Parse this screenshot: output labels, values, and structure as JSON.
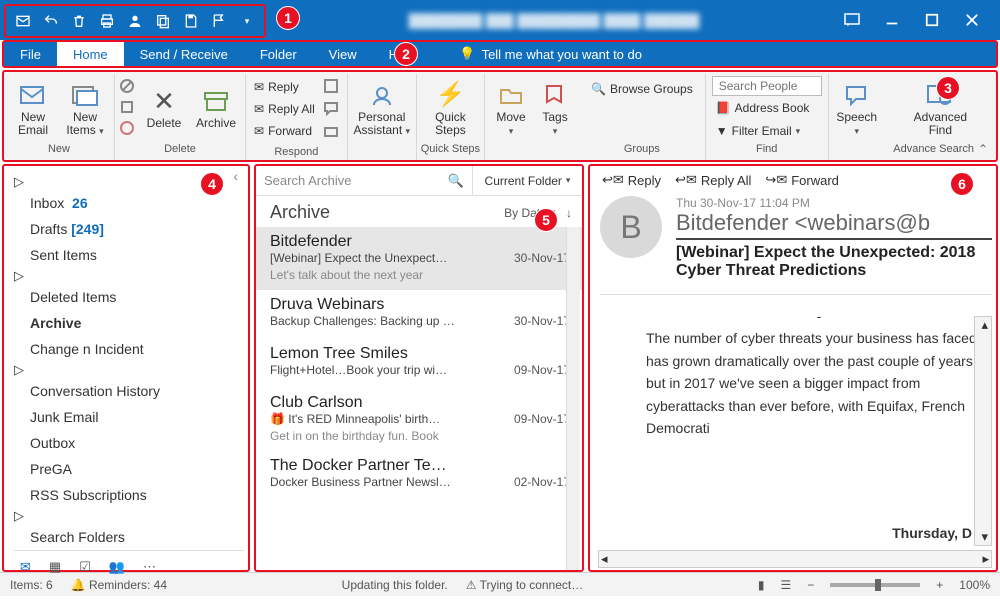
{
  "menus": {
    "file": "File",
    "home": "Home",
    "send": "Send / Receive",
    "folder": "Folder",
    "view": "View",
    "help": "Help",
    "tellme": "Tell me what you want to do"
  },
  "ribbon": {
    "new_email": "New\nEmail",
    "new_items": "New\nItems",
    "group_new": "New",
    "delete": "Delete",
    "archive": "Archive",
    "group_delete": "Delete",
    "reply": "Reply",
    "reply_all": "Reply All",
    "forward": "Forward",
    "group_respond": "Respond",
    "personal": "Personal\nAssistant",
    "quick_steps": "Quick\nSteps",
    "group_quicksteps": "Quick Steps",
    "move": "Move",
    "tags": "Tags",
    "browse_groups": "Browse Groups",
    "group_groups": "Groups",
    "search_people": "Search People",
    "address_book": "Address Book",
    "filter_email": "Filter Email",
    "group_find": "Find",
    "speech": "Speech",
    "adv_find": "Advanced\nFind",
    "group_advsearch": "Advance Search"
  },
  "nav": {
    "inbox": "Inbox",
    "inbox_count": "26",
    "drafts": "Drafts",
    "drafts_count": "[249]",
    "sent": "Sent Items",
    "deleted": "Deleted Items",
    "archive": "Archive",
    "change": "Change n Incident",
    "convhist": "Conversation History",
    "junk": "Junk Email",
    "outbox": "Outbox",
    "prega": "PreGA",
    "rss": "RSS Subscriptions",
    "search_folders": "Search Folders"
  },
  "list": {
    "search_placeholder": "Search Archive",
    "scope": "Current Folder",
    "title": "Archive",
    "sort": "By Date",
    "items": [
      {
        "from": "Bitdefender",
        "subj": "[Webinar] Expect the Unexpect…",
        "date": "30-Nov-17",
        "prev": "Let's talk about the next year"
      },
      {
        "from": "Druva Webinars",
        "subj": "Backup Challenges: Backing up …",
        "date": "30-Nov-17",
        "prev": ""
      },
      {
        "from": "Lemon Tree Smiles",
        "subj": "Flight+Hotel…Book your trip wi…",
        "date": "09-Nov-17",
        "prev": ""
      },
      {
        "from": "Club Carlson",
        "subj": "🎁 It's RED Minneapolis' birth…",
        "date": "09-Nov-17",
        "prev": "Get in on the birthday fun. Book"
      },
      {
        "from": "The Docker Partner Te…",
        "subj": "Docker Business Partner Newsl…",
        "date": "02-Nov-17",
        "prev": ""
      }
    ]
  },
  "reading": {
    "reply": "Reply",
    "reply_all": "Reply All",
    "forward": "Forward",
    "avatar": "B",
    "date": "Thu 30-Nov-17 11:04 PM",
    "from": "Bitdefender <webinars@b",
    "subject": "[Webinar] Expect the Unexpected: 2018 Cyber Threat Predictions",
    "body_line": "The number of cyber threats your business has faced has grown dramatically over the past couple of years, but in 2017 we've seen a bigger impact from cyberattacks than ever before, with Equifax, French Democrati",
    "body_date": "Thursday, D"
  },
  "status": {
    "items": "Items: 6",
    "reminders": "Reminders: 44",
    "updating": "Updating this folder.",
    "connect": "Trying to connect…",
    "zoom": "100%"
  },
  "callouts": {
    "c1": "1",
    "c2": "2",
    "c3": "3",
    "c4": "4",
    "c5": "5",
    "c6": "6"
  }
}
